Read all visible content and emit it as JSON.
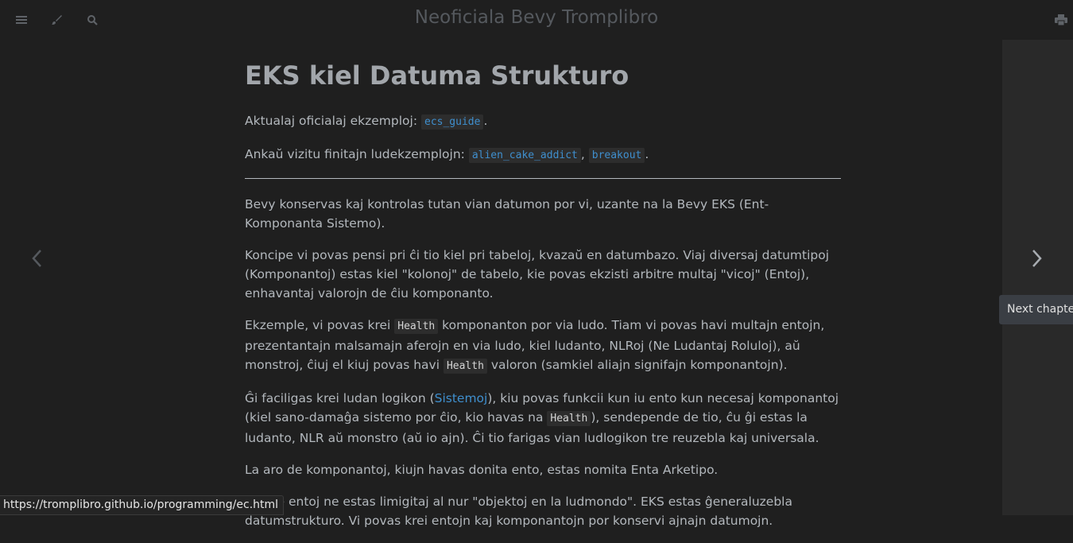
{
  "header": {
    "book_title": "Neoficiala Bevy Tromplibro",
    "icons": [
      "menu-icon",
      "paintbrush-icon",
      "search-icon",
      "print-icon"
    ]
  },
  "nav": {
    "prev_icon": "chevron-left-icon",
    "next_icon": "chevron-right-icon",
    "next_tooltip": "Next chapter"
  },
  "article": {
    "title": "EKS kiel Datuma Strukturo",
    "p1_text": "Aktualaj oficialaj ekzemploj: ",
    "p1_code": "ecs_guide",
    "p1_end": ".",
    "p2_text": "Ankaŭ vizitu finitajn ludekzemplojn: ",
    "p2_code1": "alien_cake_addict",
    "p2_sep": ", ",
    "p2_code2": "breakout",
    "p2_end": ".",
    "p3": "Bevy konservas kaj kontrolas tutan vian datumon por vi, uzante na la Bevy EKS (Ent-Komponanta Sistemo).",
    "p4": "Koncipe vi povas pensi pri ĉi tio kiel pri tabeloj, kvazaŭ en datumbazo. Viaj diversaj datumtipoj (Komponantoj) estas kiel \"kolonoj\" de tabelo, kie povas ekzisti arbitre multaj \"vicoj\" (Entoj), enhavantaj valorojn de ĉiu komponanto.",
    "p5_a": "Ekzemple, vi povas krei ",
    "p5_code1": "Health",
    "p5_b": " komponanton por via ludo. Tiam vi povas havi multajn entojn, prezentantajn malsamajn aferojn en via ludo, kiel ludanto, NLRoj (Ne Ludantaj Roluloj), aŭ monstroj, ĉiuj el kiuj povas havi ",
    "p5_code2": "Health",
    "p5_c": " valoron (samkiel aliajn signifajn komponantojn).",
    "p6_a": "Ĝi faciligas krei ludan logikon (",
    "p6_link": "Sistemoj",
    "p6_b": "), kiu povas funkcii kun iu ento kun necesaj komponantoj (kiel sano-damaĝa sistemo por ĉio, kio havas na ",
    "p6_code": "Health",
    "p6_c": "), sendepende de tio, ĉu ĝi estas la ludanto, NLR aŭ monstro (aŭ io ajn). Ĉi tio farigas vian ludlogikon tre reuzebla kaj universala.",
    "p7": "La aro de komponantoj, kiujn havas donita ento, estas nomita Enta Arketipo.",
    "p8": "NB, ke entoj ne estas limigitaj al nur \"objektoj en la ludmondo\". EKS estas ĝeneraluzebla datumstrukturo. Vi povas krei entojn kaj komponantojn por konservi ajnajn datumojn."
  },
  "status_bar": {
    "url": "https://tromplibro.github.io/programming/ec.html"
  },
  "colors": {
    "background": "#1f1f1f",
    "gutter": "#292929",
    "text": "#b3b8bd",
    "link": "#3f8fce"
  }
}
